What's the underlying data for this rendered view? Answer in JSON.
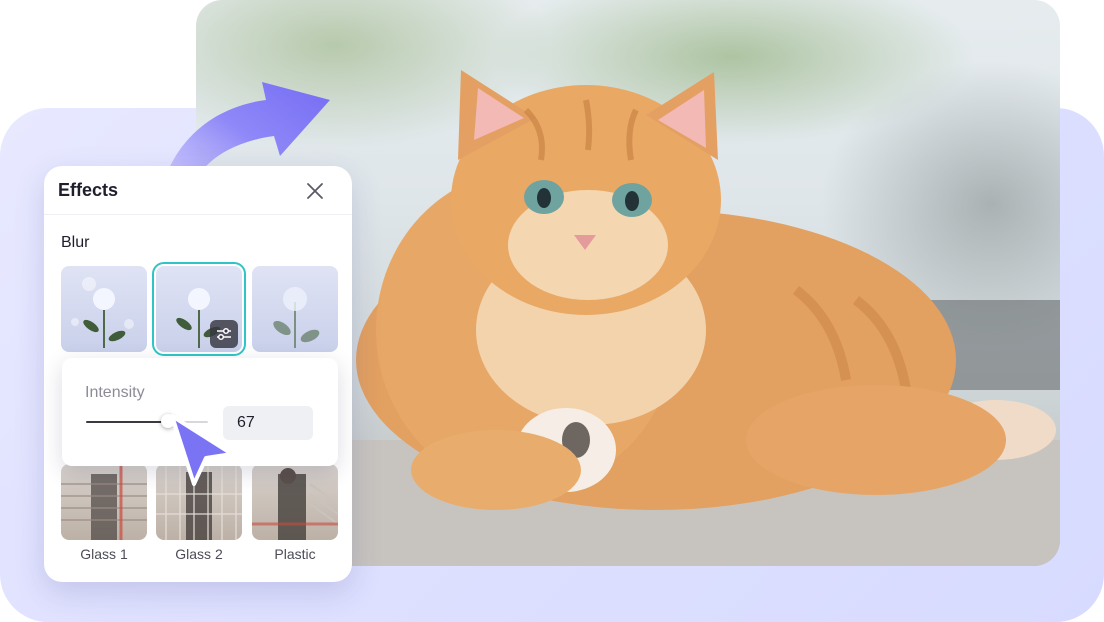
{
  "panel": {
    "title": "Effects",
    "section": "Blur",
    "intensity": {
      "label": "Intensity",
      "value": "67",
      "fraction": 0.67
    },
    "presets": [
      {
        "label": "Glass 1"
      },
      {
        "label": "Glass 2"
      },
      {
        "label": "Plastic"
      }
    ]
  },
  "colors": {
    "accent": "#7a74f5",
    "selection": "#30c5c4",
    "backdrop": "#dfe1ff"
  },
  "icons": {
    "close": "close-icon",
    "adjust": "sliders-icon",
    "arrow": "curved-arrow-icon",
    "cursor": "pointer-icon"
  }
}
